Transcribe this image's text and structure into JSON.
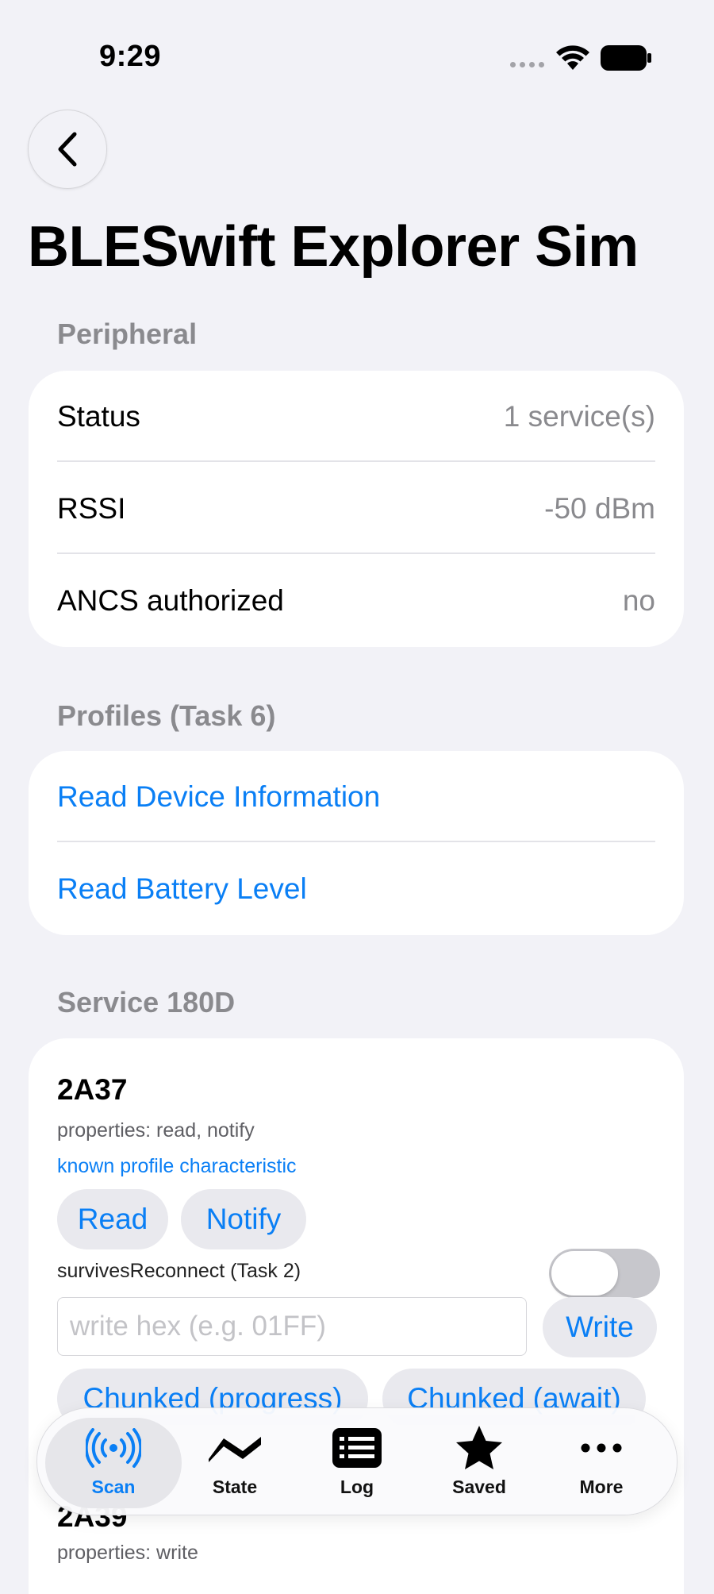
{
  "status_bar": {
    "time": "9:29"
  },
  "page_title": "BLESwift Explorer Sim",
  "peripheral": {
    "header": "Peripheral",
    "rows": [
      {
        "label": "Status",
        "value": "1 service(s)"
      },
      {
        "label": "RSSI",
        "value": "-50 dBm"
      },
      {
        "label": "ANCS authorized",
        "value": "no"
      }
    ]
  },
  "profiles": {
    "header": "Profiles (Task 6)",
    "items": [
      "Read Device Information",
      "Read Battery Level"
    ]
  },
  "service": {
    "header": "Service 180D",
    "char1": {
      "name": "2A37",
      "properties": "properties: read, notify",
      "known": "known profile characteristic",
      "read_label": "Read",
      "notify_label": "Notify",
      "survives_label": "survivesReconnect (Task 2)",
      "survives_on": false,
      "write_placeholder": "write hex (e.g. 01FF)",
      "write_label": "Write",
      "chunked_progress_label": "Chunked (progress)",
      "chunked_await_label": "Chunked (await)"
    },
    "char2": {
      "name": "2A39",
      "properties": "properties: write"
    }
  },
  "tabbar": {
    "tabs": [
      {
        "label": "Scan",
        "icon": "antenna-icon",
        "active": true
      },
      {
        "label": "State",
        "icon": "waveform-icon",
        "active": false
      },
      {
        "label": "Log",
        "icon": "list-icon",
        "active": false
      },
      {
        "label": "Saved",
        "icon": "star-icon",
        "active": false
      },
      {
        "label": "More",
        "icon": "ellipsis-icon",
        "active": false
      }
    ]
  },
  "colors": {
    "accent": "#0a7ff5",
    "background": "#f2f2f7",
    "secondary_text": "#8a8a8e"
  }
}
